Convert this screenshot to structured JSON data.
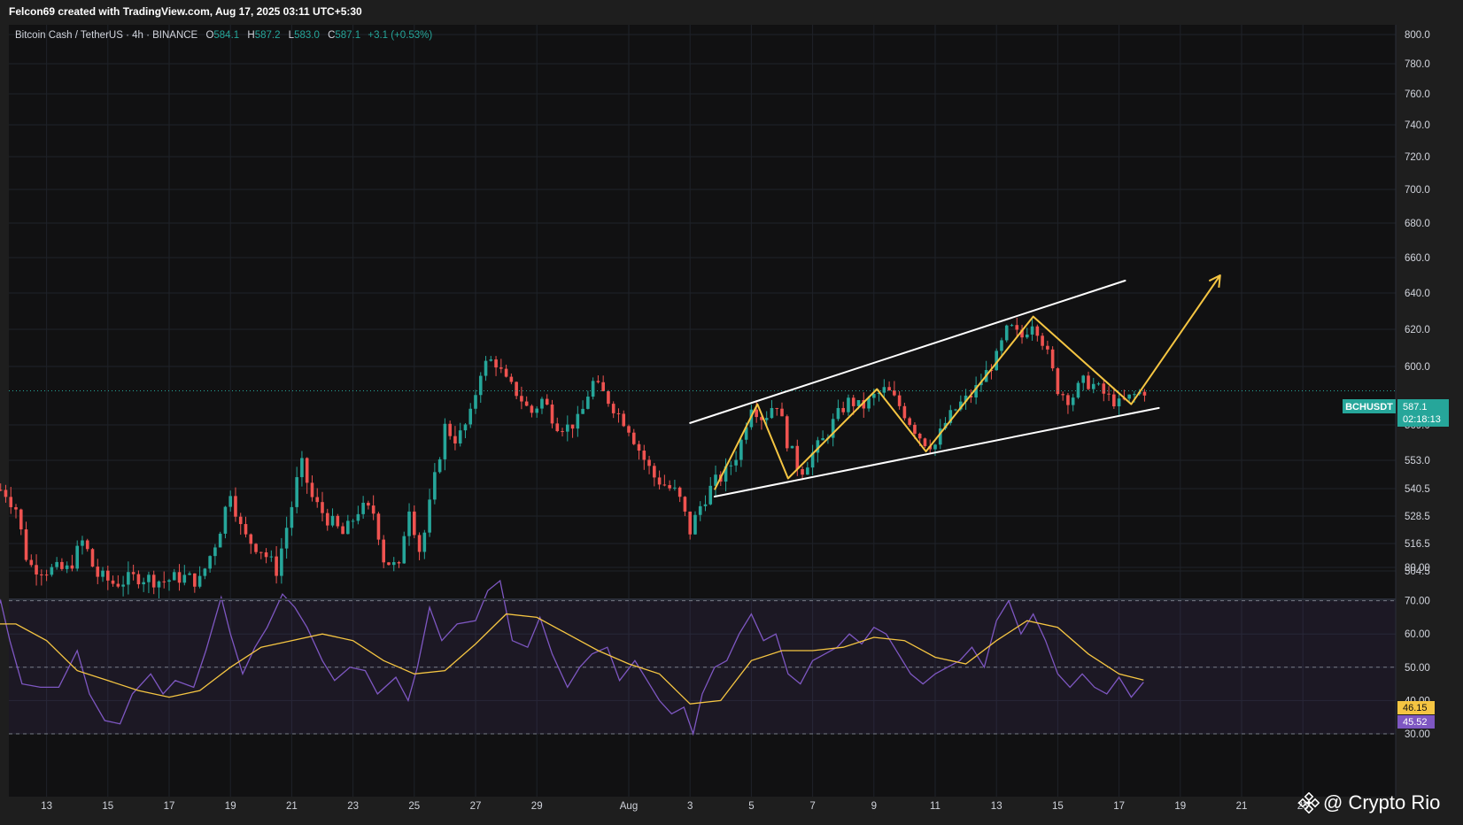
{
  "credit": "Felcon69 created with TradingView.com, Aug 17, 2025 03:11 UTC+5:30",
  "legend": {
    "symbol": "Bitcoin Cash / TetherUS · 4h · BINANCE",
    "o_label": "O",
    "o_value": "584.1",
    "h_label": "H",
    "h_value": "587.2",
    "l_label": "L",
    "l_value": "583.0",
    "c_label": "C",
    "c_value": "587.1",
    "change": "+3.1 (+0.53%)"
  },
  "price_badge": {
    "ticker": "BCHUSDT",
    "price": "587.1",
    "countdown": "02:18:13"
  },
  "rsi_badges": {
    "ma": "46.15",
    "rsi": "45.52"
  },
  "watermark": "@ Crypto Rio",
  "colors": {
    "background": "#111112",
    "up": "#26a69a",
    "down": "#ef5350",
    "rsi": "#7e57c2",
    "rsi_ma": "#f5c542",
    "pattern": "#f5c542",
    "channel": "#ffffff"
  },
  "chart_data": [
    {
      "type": "candlestick",
      "price_ticks": [
        "800.0",
        "780.0",
        "760.0",
        "740.0",
        "720.0",
        "700.0",
        "680.0",
        "660.0",
        "640.0",
        "620.0",
        "600.0",
        "569.0",
        "553.0",
        "540.5",
        "528.5",
        "516.5",
        "504.5"
      ],
      "price_tick_values": [
        800,
        780,
        760,
        740,
        720,
        700,
        680,
        660,
        640,
        620,
        600,
        569,
        553,
        540.5,
        528.5,
        516.5,
        504.5
      ],
      "x_ticks": [
        "13",
        "15",
        "17",
        "19",
        "21",
        "23",
        "25",
        "27",
        "29",
        "Aug",
        "3",
        "5",
        "7",
        "9",
        "11",
        "13",
        "15",
        "17",
        "19",
        "21",
        "23"
      ],
      "x_tick_days": [
        -19,
        -17,
        -15,
        -13,
        -11,
        -9,
        -7,
        -5,
        -3,
        0,
        2,
        4,
        6,
        8,
        10,
        12,
        14,
        16,
        18,
        20,
        22
      ],
      "time_unit": "days from Aug 1",
      "ylim": [
        495,
        805
      ],
      "last_price": 587.1,
      "closes": [
        {
          "t": -20.4,
          "c": 540
        },
        {
          "t": -20,
          "c": 532
        },
        {
          "t": -19.6,
          "c": 507
        },
        {
          "t": -19,
          "c": 505
        },
        {
          "t": -18.3,
          "c": 505
        },
        {
          "t": -17.8,
          "c": 518
        },
        {
          "t": -17.4,
          "c": 503
        },
        {
          "t": -16.8,
          "c": 499
        },
        {
          "t": -16,
          "c": 502
        },
        {
          "t": -15.2,
          "c": 500
        },
        {
          "t": -14.6,
          "c": 502
        },
        {
          "t": -14,
          "c": 500
        },
        {
          "t": -13.4,
          "c": 520
        },
        {
          "t": -13,
          "c": 540
        },
        {
          "t": -12.6,
          "c": 520
        },
        {
          "t": -12,
          "c": 514
        },
        {
          "t": -11.5,
          "c": 505
        },
        {
          "t": -11,
          "c": 533
        },
        {
          "t": -10.7,
          "c": 552
        },
        {
          "t": -10.3,
          "c": 535
        },
        {
          "t": -9.8,
          "c": 527
        },
        {
          "t": -9.3,
          "c": 520
        },
        {
          "t": -8.8,
          "c": 532
        },
        {
          "t": -8.3,
          "c": 530
        },
        {
          "t": -8,
          "c": 510
        },
        {
          "t": -7.5,
          "c": 505
        },
        {
          "t": -7.2,
          "c": 535
        },
        {
          "t": -6.8,
          "c": 512
        },
        {
          "t": -6.4,
          "c": 540
        },
        {
          "t": -6,
          "c": 568
        },
        {
          "t": -5.6,
          "c": 562
        },
        {
          "t": -5.2,
          "c": 572
        },
        {
          "t": -4.8,
          "c": 600
        },
        {
          "t": -4.4,
          "c": 604
        },
        {
          "t": -4,
          "c": 592
        },
        {
          "t": -3.6,
          "c": 585
        },
        {
          "t": -3.2,
          "c": 575
        },
        {
          "t": -2.8,
          "c": 583
        },
        {
          "t": -2.4,
          "c": 570
        },
        {
          "t": -2,
          "c": 568
        },
        {
          "t": -1.6,
          "c": 572
        },
        {
          "t": -1.2,
          "c": 592
        },
        {
          "t": -0.8,
          "c": 585
        },
        {
          "t": -0.4,
          "c": 576
        },
        {
          "t": 0,
          "c": 568
        },
        {
          "t": 0.4,
          "c": 556
        },
        {
          "t": 0.8,
          "c": 546
        },
        {
          "t": 1.2,
          "c": 542
        },
        {
          "t": 1.6,
          "c": 538
        },
        {
          "t": 2,
          "c": 522
        },
        {
          "t": 2.4,
          "c": 535
        },
        {
          "t": 2.8,
          "c": 543
        },
        {
          "t": 3.2,
          "c": 548
        },
        {
          "t": 3.6,
          "c": 558
        },
        {
          "t": 4,
          "c": 580
        },
        {
          "t": 4.4,
          "c": 572
        },
        {
          "t": 4.8,
          "c": 582
        },
        {
          "t": 5.2,
          "c": 560
        },
        {
          "t": 5.6,
          "c": 548
        },
        {
          "t": 6,
          "c": 556
        },
        {
          "t": 6.4,
          "c": 563
        },
        {
          "t": 6.8,
          "c": 574
        },
        {
          "t": 7.2,
          "c": 582
        },
        {
          "t": 7.6,
          "c": 578
        },
        {
          "t": 8,
          "c": 584
        },
        {
          "t": 8.4,
          "c": 588
        },
        {
          "t": 8.8,
          "c": 580
        },
        {
          "t": 9.2,
          "c": 570
        },
        {
          "t": 9.6,
          "c": 562
        },
        {
          "t": 10,
          "c": 560
        },
        {
          "t": 10.4,
          "c": 572
        },
        {
          "t": 10.8,
          "c": 580
        },
        {
          "t": 11.2,
          "c": 585
        },
        {
          "t": 11.6,
          "c": 595
        },
        {
          "t": 12,
          "c": 605
        },
        {
          "t": 12.4,
          "c": 622
        },
        {
          "t": 12.8,
          "c": 615
        },
        {
          "t": 13.2,
          "c": 625
        },
        {
          "t": 13.6,
          "c": 610
        },
        {
          "t": 14,
          "c": 588
        },
        {
          "t": 14.4,
          "c": 582
        },
        {
          "t": 14.8,
          "c": 592
        },
        {
          "t": 15.2,
          "c": 590
        },
        {
          "t": 15.6,
          "c": 584
        },
        {
          "t": 16,
          "c": 580
        },
        {
          "t": 16.4,
          "c": 584
        },
        {
          "t": 16.8,
          "c": 587.1
        }
      ]
    },
    {
      "type": "line",
      "indicator": "RSI",
      "rsi_ticks": [
        "80.00",
        "70.00",
        "60.00",
        "50.00",
        "40.00",
        "30.00"
      ],
      "rsi_tick_values": [
        80,
        70,
        60,
        50,
        40,
        30
      ],
      "ylim": [
        28,
        82
      ],
      "band": [
        30,
        70
      ],
      "series": [
        {
          "t": -20.8,
          "v": 63
        },
        {
          "t": -20.5,
          "v": 70
        },
        {
          "t": -20.2,
          "v": 58
        },
        {
          "t": -19.8,
          "v": 45
        },
        {
          "t": -19.2,
          "v": 44
        },
        {
          "t": -18.6,
          "v": 44
        },
        {
          "t": -18,
          "v": 55
        },
        {
          "t": -17.6,
          "v": 42
        },
        {
          "t": -17.1,
          "v": 34
        },
        {
          "t": -16.6,
          "v": 33
        },
        {
          "t": -16.2,
          "v": 42
        },
        {
          "t": -15.6,
          "v": 48
        },
        {
          "t": -15.2,
          "v": 42
        },
        {
          "t": -14.8,
          "v": 46
        },
        {
          "t": -14.2,
          "v": 44
        },
        {
          "t": -13.8,
          "v": 55
        },
        {
          "t": -13.3,
          "v": 71
        },
        {
          "t": -13,
          "v": 60
        },
        {
          "t": -12.6,
          "v": 48
        },
        {
          "t": -12.2,
          "v": 56
        },
        {
          "t": -11.8,
          "v": 62
        },
        {
          "t": -11.3,
          "v": 72
        },
        {
          "t": -10.9,
          "v": 68
        },
        {
          "t": -10.5,
          "v": 62
        },
        {
          "t": -10,
          "v": 52
        },
        {
          "t": -9.6,
          "v": 46
        },
        {
          "t": -9.1,
          "v": 50
        },
        {
          "t": -8.6,
          "v": 49
        },
        {
          "t": -8.2,
          "v": 42
        },
        {
          "t": -7.6,
          "v": 47
        },
        {
          "t": -7.2,
          "v": 40
        },
        {
          "t": -6.9,
          "v": 50
        },
        {
          "t": -6.5,
          "v": 68
        },
        {
          "t": -6.1,
          "v": 58
        },
        {
          "t": -5.6,
          "v": 63
        },
        {
          "t": -5,
          "v": 64
        },
        {
          "t": -4.6,
          "v": 73
        },
        {
          "t": -4.2,
          "v": 76
        },
        {
          "t": -3.8,
          "v": 58
        },
        {
          "t": -3.3,
          "v": 56
        },
        {
          "t": -2.9,
          "v": 65
        },
        {
          "t": -2.5,
          "v": 54
        },
        {
          "t": -2,
          "v": 44
        },
        {
          "t": -1.6,
          "v": 50
        },
        {
          "t": -1.2,
          "v": 54
        },
        {
          "t": -0.7,
          "v": 56
        },
        {
          "t": -0.3,
          "v": 46
        },
        {
          "t": 0.2,
          "v": 52
        },
        {
          "t": 0.6,
          "v": 46
        },
        {
          "t": 1,
          "v": 40
        },
        {
          "t": 1.4,
          "v": 36
        },
        {
          "t": 1.8,
          "v": 38
        },
        {
          "t": 2.1,
          "v": 30
        },
        {
          "t": 2.4,
          "v": 42
        },
        {
          "t": 2.8,
          "v": 50
        },
        {
          "t": 3.2,
          "v": 52
        },
        {
          "t": 3.6,
          "v": 60
        },
        {
          "t": 4,
          "v": 66
        },
        {
          "t": 4.4,
          "v": 58
        },
        {
          "t": 4.8,
          "v": 60
        },
        {
          "t": 5.2,
          "v": 48
        },
        {
          "t": 5.6,
          "v": 45
        },
        {
          "t": 6,
          "v": 52
        },
        {
          "t": 6.4,
          "v": 54
        },
        {
          "t": 6.8,
          "v": 56
        },
        {
          "t": 7.2,
          "v": 60
        },
        {
          "t": 7.6,
          "v": 57
        },
        {
          "t": 8,
          "v": 62
        },
        {
          "t": 8.4,
          "v": 60
        },
        {
          "t": 8.8,
          "v": 54
        },
        {
          "t": 9.2,
          "v": 48
        },
        {
          "t": 9.6,
          "v": 45
        },
        {
          "t": 10,
          "v": 48
        },
        {
          "t": 10.4,
          "v": 50
        },
        {
          "t": 10.8,
          "v": 52
        },
        {
          "t": 11.2,
          "v": 56
        },
        {
          "t": 11.6,
          "v": 50
        },
        {
          "t": 12,
          "v": 64
        },
        {
          "t": 12.4,
          "v": 70
        },
        {
          "t": 12.8,
          "v": 60
        },
        {
          "t": 13.2,
          "v": 66
        },
        {
          "t": 13.6,
          "v": 58
        },
        {
          "t": 14,
          "v": 48
        },
        {
          "t": 14.4,
          "v": 44
        },
        {
          "t": 14.8,
          "v": 48
        },
        {
          "t": 15.2,
          "v": 44
        },
        {
          "t": 15.6,
          "v": 42
        },
        {
          "t": 16,
          "v": 47
        },
        {
          "t": 16.4,
          "v": 41
        },
        {
          "t": 16.8,
          "v": 45.5
        }
      ],
      "ma_series": [
        {
          "t": -20.8,
          "v": 63
        },
        {
          "t": -20,
          "v": 63
        },
        {
          "t": -19,
          "v": 58
        },
        {
          "t": -18,
          "v": 49
        },
        {
          "t": -17,
          "v": 46
        },
        {
          "t": -16,
          "v": 43
        },
        {
          "t": -15,
          "v": 41
        },
        {
          "t": -14,
          "v": 43
        },
        {
          "t": -13,
          "v": 50
        },
        {
          "t": -12,
          "v": 56
        },
        {
          "t": -11,
          "v": 58
        },
        {
          "t": -10,
          "v": 60
        },
        {
          "t": -9,
          "v": 58
        },
        {
          "t": -8,
          "v": 52
        },
        {
          "t": -7,
          "v": 48
        },
        {
          "t": -6,
          "v": 49
        },
        {
          "t": -5,
          "v": 57
        },
        {
          "t": -4,
          "v": 66
        },
        {
          "t": -3,
          "v": 65
        },
        {
          "t": -2,
          "v": 60
        },
        {
          "t": -1,
          "v": 55
        },
        {
          "t": 0,
          "v": 51
        },
        {
          "t": 1,
          "v": 48
        },
        {
          "t": 2,
          "v": 39
        },
        {
          "t": 3,
          "v": 40
        },
        {
          "t": 4,
          "v": 52
        },
        {
          "t": 5,
          "v": 55
        },
        {
          "t": 6,
          "v": 55
        },
        {
          "t": 7,
          "v": 56
        },
        {
          "t": 8,
          "v": 59
        },
        {
          "t": 9,
          "v": 58
        },
        {
          "t": 10,
          "v": 53
        },
        {
          "t": 11,
          "v": 51
        },
        {
          "t": 12,
          "v": 58
        },
        {
          "t": 13,
          "v": 64
        },
        {
          "t": 14,
          "v": 62
        },
        {
          "t": 15,
          "v": 54
        },
        {
          "t": 16,
          "v": 48
        },
        {
          "t": 16.8,
          "v": 46.15
        }
      ]
    }
  ],
  "drawings": {
    "channel_upper": [
      {
        "t": 2,
        "p": 570
      },
      {
        "t": 16.2,
        "p": 647
      }
    ],
    "channel_lower": [
      {
        "t": 2.8,
        "p": 537
      },
      {
        "t": 17.3,
        "p": 578
      }
    ],
    "zigzag": [
      {
        "t": 2.8,
        "p": 540
      },
      {
        "t": 4.2,
        "p": 580
      },
      {
        "t": 5.2,
        "p": 545
      },
      {
        "t": 8.1,
        "p": 588
      },
      {
        "t": 9.7,
        "p": 557
      },
      {
        "t": 13.2,
        "p": 627
      },
      {
        "t": 16.4,
        "p": 580
      },
      {
        "t": 19.3,
        "p": 650
      }
    ]
  }
}
